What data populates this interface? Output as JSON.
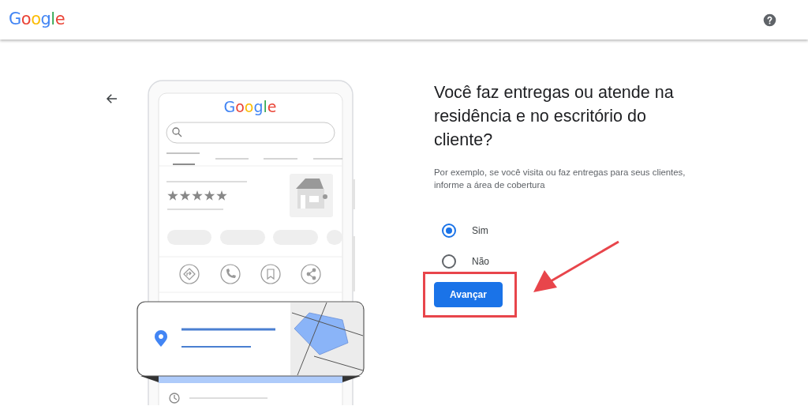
{
  "header": {
    "logo": "Google"
  },
  "illustration": {
    "logo": "Google"
  },
  "question": {
    "title": "Você faz entregas ou atende na residência e no escritório do cliente?",
    "description": "Por exemplo, se você visita ou faz entregas para seus clientes, informe a área de cobertura"
  },
  "options": [
    {
      "label": "Sim",
      "selected": true
    },
    {
      "label": "Não",
      "selected": false
    }
  ],
  "next_button": "Avançar"
}
